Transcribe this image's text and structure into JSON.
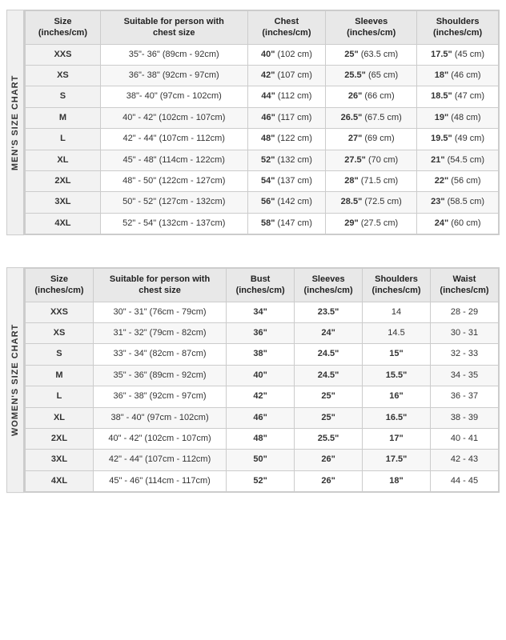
{
  "mens": {
    "label": "MEN'S SIZE CHART",
    "headers": [
      "Size\n(inches/cm)",
      "Suitable for person with\nchest size",
      "Chest\n(inches/cm)",
      "Sleeves\n(inches/cm)",
      "Shoulders\n(inches/cm)"
    ],
    "rows": [
      [
        "XXS",
        "35\"- 36\" (89cm - 92cm)",
        "40\" (102 cm)",
        "25\" (63.5 cm)",
        "17.5\" (45 cm)"
      ],
      [
        "XS",
        "36\"- 38\" (92cm - 97cm)",
        "42\" (107 cm)",
        "25.5\" (65 cm)",
        "18\" (46 cm)"
      ],
      [
        "S",
        "38\"- 40\" (97cm - 102cm)",
        "44\" (112 cm)",
        "26\" (66 cm)",
        "18.5\" (47 cm)"
      ],
      [
        "M",
        "40\" - 42\" (102cm - 107cm)",
        "46\" (117 cm)",
        "26.5\" (67.5 cm)",
        "19\" (48 cm)"
      ],
      [
        "L",
        "42\" - 44\" (107cm - 112cm)",
        "48\" (122 cm)",
        "27\" (69 cm)",
        "19.5\" (49 cm)"
      ],
      [
        "XL",
        "45\" - 48\" (114cm - 122cm)",
        "52\" (132 cm)",
        "27.5\" (70 cm)",
        "21\" (54.5 cm)"
      ],
      [
        "2XL",
        "48\" - 50\" (122cm - 127cm)",
        "54\" (137 cm)",
        "28\" (71.5 cm)",
        "22\" (56 cm)"
      ],
      [
        "3XL",
        "50\" - 52\" (127cm - 132cm)",
        "56\" (142 cm)",
        "28.5\" (72.5 cm)",
        "23\" (58.5 cm)"
      ],
      [
        "4XL",
        "52\" - 54\" (132cm - 137cm)",
        "58\" (147 cm)",
        "29\" (27.5 cm)",
        "24\" (60 cm)"
      ]
    ]
  },
  "womens": {
    "label": "WOMEN'S SIZE CHART",
    "headers": [
      "Size\n(inches/cm)",
      "Suitable for person with\nchest size",
      "Bust\n(inches/cm)",
      "Sleeves\n(inches/cm)",
      "Shoulders\n(inches/cm)",
      "Waist\n(inches/cm)"
    ],
    "rows": [
      [
        "XXS",
        "30\" - 31\" (76cm - 79cm)",
        "34\"",
        "23.5\"",
        "14",
        "28 - 29"
      ],
      [
        "XS",
        "31\" - 32\" (79cm - 82cm)",
        "36\"",
        "24\"",
        "14.5",
        "30 - 31"
      ],
      [
        "S",
        "33\" - 34\" (82cm - 87cm)",
        "38\"",
        "24.5\"",
        "15\"",
        "32 - 33"
      ],
      [
        "M",
        "35\" - 36\" (89cm - 92cm)",
        "40\"",
        "24.5\"",
        "15.5\"",
        "34 - 35"
      ],
      [
        "L",
        "36\" - 38\" (92cm - 97cm)",
        "42\"",
        "25\"",
        "16\"",
        "36 - 37"
      ],
      [
        "XL",
        "38\" - 40\" (97cm - 102cm)",
        "46\"",
        "25\"",
        "16.5\"",
        "38 - 39"
      ],
      [
        "2XL",
        "40\" - 42\" (102cm - 107cm)",
        "48\"",
        "25.5\"",
        "17\"",
        "40 - 41"
      ],
      [
        "3XL",
        "42\" - 44\" (107cm - 112cm)",
        "50\"",
        "26\"",
        "17.5\"",
        "42 - 43"
      ],
      [
        "4XL",
        "45\" - 46\" (114cm - 117cm)",
        "52\"",
        "26\"",
        "18\"",
        "44 - 45"
      ]
    ]
  }
}
